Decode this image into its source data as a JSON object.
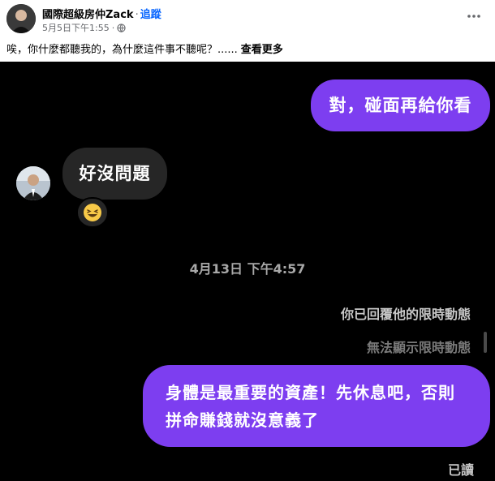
{
  "post": {
    "author": "國際超級房仲Zack",
    "separator": "·",
    "follow_label": "追蹤",
    "timestamp": "5月5日下午1:55",
    "meta_separator": "·",
    "privacy_icon": "globe-icon",
    "more_icon": "more-horizontal-icon",
    "text": "唉，你什麼都聽我的，為什麼這件事不聽呢？......",
    "see_more_label": "查看更多"
  },
  "chat": {
    "outgoing_1": "對，碰面再給你看",
    "incoming_1": "好沒問題",
    "reaction_emoji": "😆",
    "date_divider": "4月13日 下午4:57",
    "story_reply_note": "你已回覆他的限時動態",
    "story_unavailable_note": "無法顯示限時動態",
    "outgoing_2_line1": "身體是最重要的資產！先休息吧，否則",
    "outgoing_2_line2": "拼命賺錢就沒意義了",
    "read_receipt": "已讀"
  },
  "colors": {
    "sent_bubble": "#7d3ef0",
    "received_bubble": "#262626",
    "chat_background": "#000000",
    "link_blue": "#0866ff"
  }
}
